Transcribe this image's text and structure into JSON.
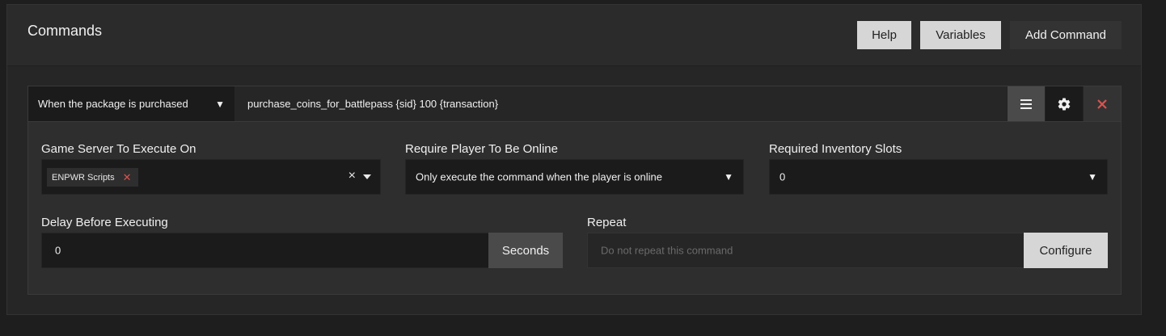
{
  "header": {
    "title": "Commands",
    "help_label": "Help",
    "variables_label": "Variables",
    "add_command_label": "Add Command"
  },
  "command": {
    "trigger": "When the package is purchased",
    "text": "purchase_coins_for_battlepass {sid} 100 {transaction}",
    "icons": {
      "menu": "hamburger-icon",
      "settings": "gear-icon",
      "remove": "close-icon"
    },
    "remove_color": "#d9534f"
  },
  "game_server": {
    "label": "Game Server To Execute On",
    "selected_tag": "ENPWR Scripts",
    "clear_symbol": "×"
  },
  "require_online": {
    "label": "Require Player To Be Online",
    "value": "Only execute the command when the player is online"
  },
  "inventory_slots": {
    "label": "Required Inventory Slots",
    "value": "0"
  },
  "delay": {
    "label": "Delay Before Executing",
    "value": "0",
    "unit": "Seconds"
  },
  "repeat": {
    "label": "Repeat",
    "placeholder": "Do not repeat this command",
    "configure_label": "Configure"
  }
}
